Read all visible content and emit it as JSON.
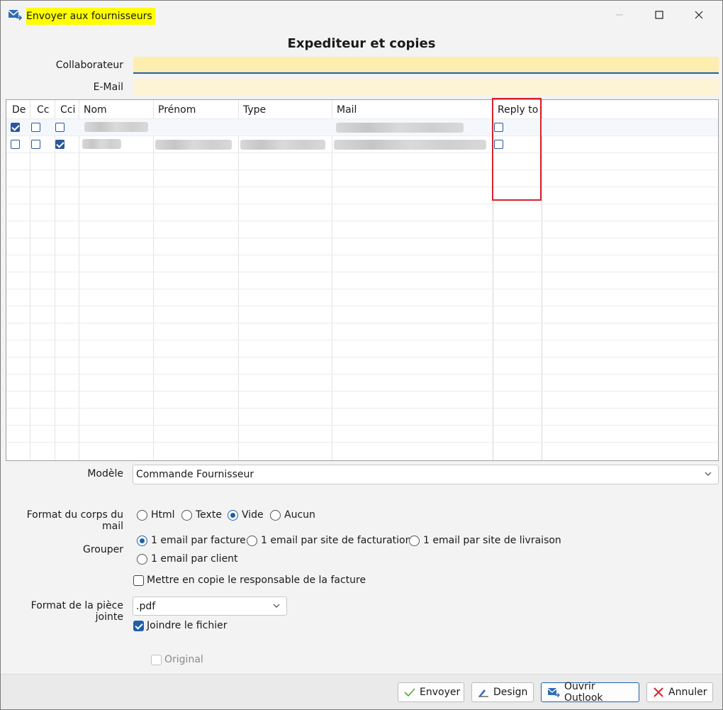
{
  "window": {
    "title": "Envoyer aux fournisseurs"
  },
  "heading": "Expediteur et copies",
  "fields": {
    "collaborateur_label": "Collaborateur",
    "collaborateur_value": "",
    "email_label": "E-Mail",
    "email_value": ""
  },
  "grid": {
    "columns": [
      "De",
      "Cc",
      "Cci",
      "Nom",
      "Prénom",
      "Type",
      "Mail",
      "Reply to"
    ],
    "rows": [
      {
        "de": true,
        "cc": false,
        "cci": false,
        "reply_to": false
      },
      {
        "de": false,
        "cc": false,
        "cci": true,
        "reply_to": false
      }
    ]
  },
  "modele": {
    "label": "Modèle",
    "value": "Commande Fournisseur"
  },
  "format_corps": {
    "label": "Format du corps du mail",
    "options": [
      "Html",
      "Texte",
      "Vide",
      "Aucun"
    ],
    "selected": "Vide"
  },
  "grouper": {
    "label": "Grouper",
    "options": [
      "1 email par facture",
      "1 email par site de facturation",
      "1 email par site de livraison",
      "1 email par client"
    ],
    "selected": "1 email par facture"
  },
  "copie_responsable": {
    "label": "Mettre en copie le responsable de la facture",
    "checked": false
  },
  "piece_jointe": {
    "label": "Format de la pièce jointe",
    "value": ".pdf"
  },
  "joindre": {
    "label": "Joindre le fichier",
    "checked": true
  },
  "original": {
    "label": "Original",
    "checked": false,
    "disabled": true
  },
  "buttons": {
    "envoyer": "Envoyer",
    "design": "Design",
    "ouvrir_outlook": "Ouvrir Outlook",
    "annuler": "Annuler"
  },
  "colors": {
    "accent": "#1f5fa8",
    "title_highlight": "#ffff00",
    "annotation_box": "#d9232d",
    "field_bg": "#fdeeb0"
  }
}
